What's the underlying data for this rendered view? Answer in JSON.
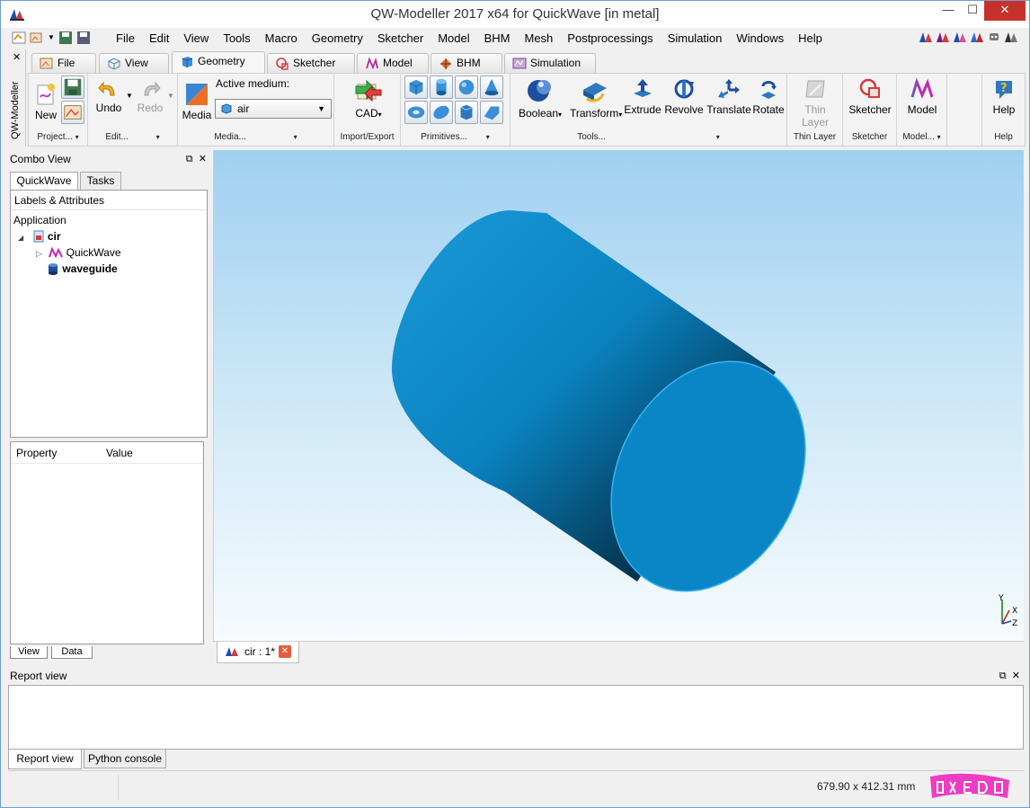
{
  "window": {
    "title": "QW-Modeller 2017 x64 for QuickWave [in metal]",
    "min": "—",
    "max": "☐",
    "close": "✕"
  },
  "menu": [
    "File",
    "Edit",
    "View",
    "Tools",
    "Macro",
    "Geometry",
    "Sketcher",
    "Model",
    "BHM",
    "Mesh",
    "Postprocessings",
    "Simulation",
    "Windows",
    "Help"
  ],
  "side_strip": {
    "close": "✕",
    "label": "QW-Modeller"
  },
  "ribbon_tabs": [
    {
      "label": "File",
      "active": false
    },
    {
      "label": "View",
      "active": false
    },
    {
      "label": "Geometry",
      "active": true
    },
    {
      "label": "Sketcher",
      "active": false
    },
    {
      "label": "Model",
      "active": false
    },
    {
      "label": "BHM",
      "active": false
    },
    {
      "label": "Simulation",
      "active": false
    }
  ],
  "ribbon": {
    "project": {
      "new": "New",
      "label": "Project..."
    },
    "edit": {
      "undo": "Undo",
      "redo": "Redo",
      "label": "Edit..."
    },
    "media": {
      "button": "Media",
      "active_label": "Active medium:",
      "active_value": "air",
      "label": "Media..."
    },
    "import_export": {
      "cad": "CAD",
      "label": "Import/Export"
    },
    "primitives": {
      "label": "Primitives..."
    },
    "tools": {
      "boolean": "Boolean",
      "transform": "Transform",
      "extrude": "Extrude",
      "revolve": "Revolve",
      "translate": "Translate",
      "rotate": "Rotate",
      "label": "Tools..."
    },
    "thin_layer": {
      "button": "Thin Layer",
      "label": "Thin Layer"
    },
    "sketcher": {
      "button": "Sketcher",
      "label": "Sketcher"
    },
    "model": {
      "button": "Model",
      "label": "Model..."
    },
    "help": {
      "button": "Help",
      "label": "Help"
    }
  },
  "combo": {
    "title": "Combo View",
    "tabs": [
      "QuickWave",
      "Tasks"
    ],
    "tree_header": "Labels & Attributes",
    "application": "Application",
    "root": "cir",
    "child1": "QuickWave",
    "child2": "waveguide",
    "prop_col": "Property",
    "value_col": "Value",
    "bottom_tabs": [
      "View",
      "Data"
    ]
  },
  "viewport": {
    "axes": {
      "y": "Y",
      "x": "X",
      "z": "Z"
    }
  },
  "doc_tab": {
    "label": "cir : 1*"
  },
  "report": {
    "title": "Report view",
    "tabs": [
      "Report view",
      "Python console"
    ]
  },
  "status": {
    "dimensions": "679.90 x 412.31 mm"
  },
  "colors": {
    "cylinder": "#0a86c6",
    "close_button": "#c7312c",
    "logo": "#ee3cc3"
  }
}
